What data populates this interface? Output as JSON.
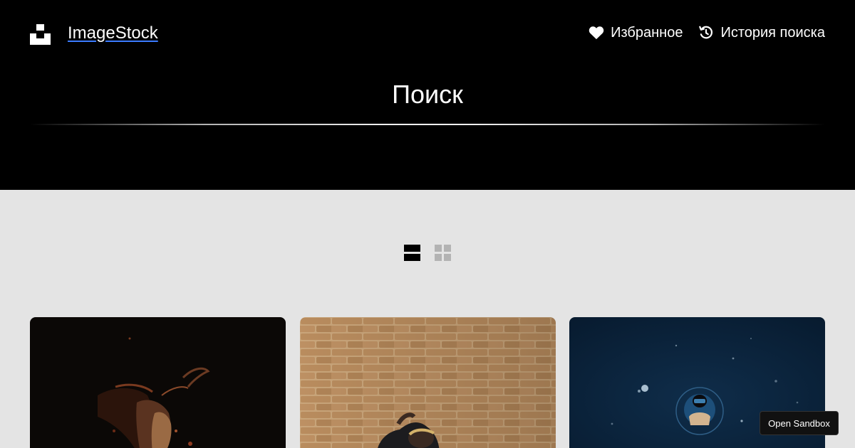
{
  "header": {
    "brand": "ImageStock",
    "nav": [
      {
        "label": "Избранное",
        "icon": "heart-icon"
      },
      {
        "label": "История поиска",
        "icon": "history-icon"
      }
    ],
    "title": "Поиск"
  },
  "view_toggle": {
    "active": "list-view",
    "options": [
      "list-view",
      "grid-view"
    ]
  },
  "results": [
    {
      "description": "dark-portrait-photo"
    },
    {
      "description": "brick-wall-photo"
    },
    {
      "description": "underwater-diver-photo"
    }
  ],
  "sandbox_button": "Open Sandbox",
  "colors": {
    "header_bg": "#000000",
    "body_bg": "#e4e4e4",
    "accent_underline": "#3b7bff"
  }
}
